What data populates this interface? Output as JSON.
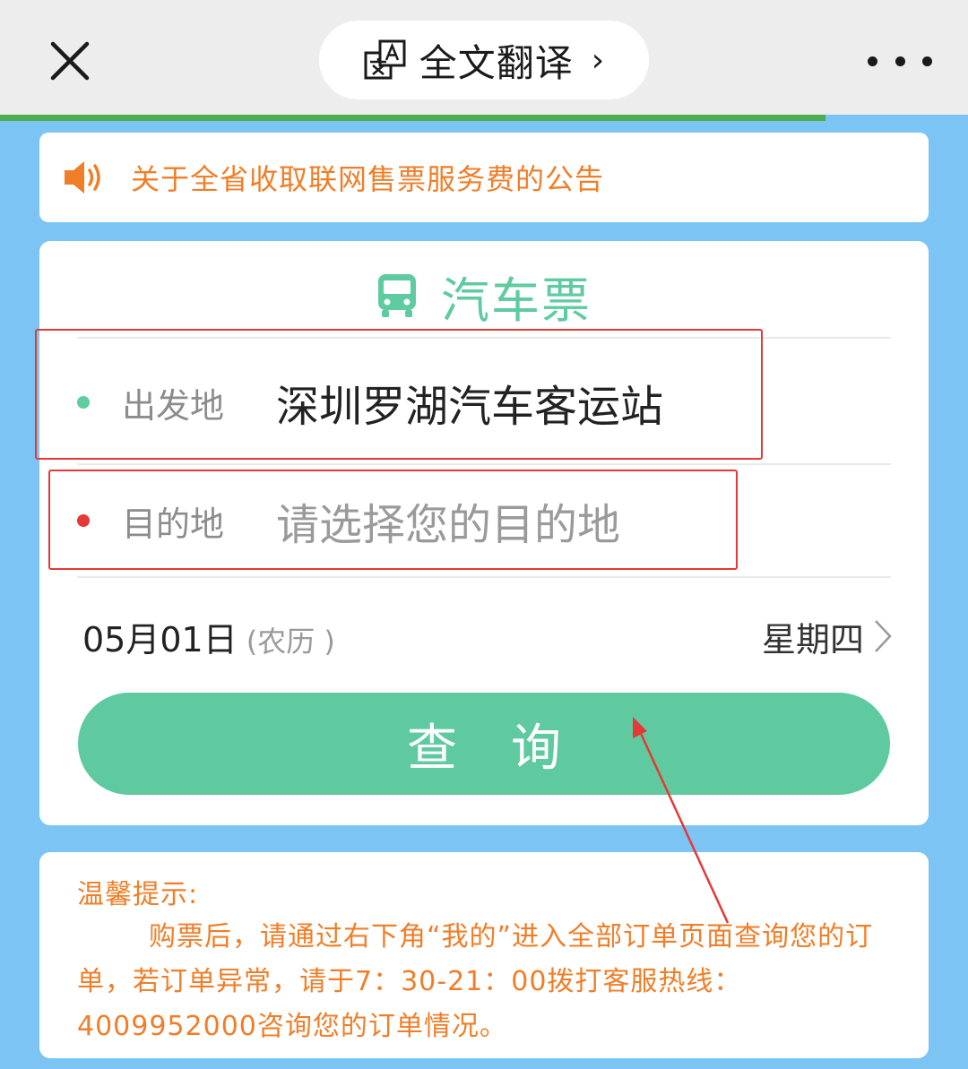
{
  "topbar": {
    "close_icon": "close-icon",
    "translate_label": "全文翻译",
    "translate_chevron": "›",
    "more_icon": "more-icon"
  },
  "progress": {
    "value": 0.853
  },
  "notice": {
    "icon": "speaker-icon",
    "text": "关于全省收取联网售票服务费的公告"
  },
  "ticket": {
    "icon": "bus-icon",
    "title": "汽车票",
    "origin": {
      "label": "出发地",
      "value": "深圳罗湖汽车客运站",
      "dot_color": "#5ecba0"
    },
    "destination": {
      "label": "目的地",
      "placeholder": "请选择您的目的地",
      "dot_color": "#e53935"
    },
    "date": {
      "value": "05月01日",
      "lunar": "(农历 )",
      "weekday": "星期四",
      "chevron": "〉"
    },
    "query_label": "查询"
  },
  "tips": {
    "heading": "温馨提示:",
    "body": "购票后，请通过右下角“我的”进入全部订单页面查询您的订单，若订单异常，请于7：30-21：00拨打客服热线：4009952000咨询您的订单情况。"
  },
  "colors": {
    "background": "#7cc4f3",
    "accent_green": "#5ecba0",
    "notice_orange": "#f07e28",
    "annotation_red": "#e53935"
  }
}
